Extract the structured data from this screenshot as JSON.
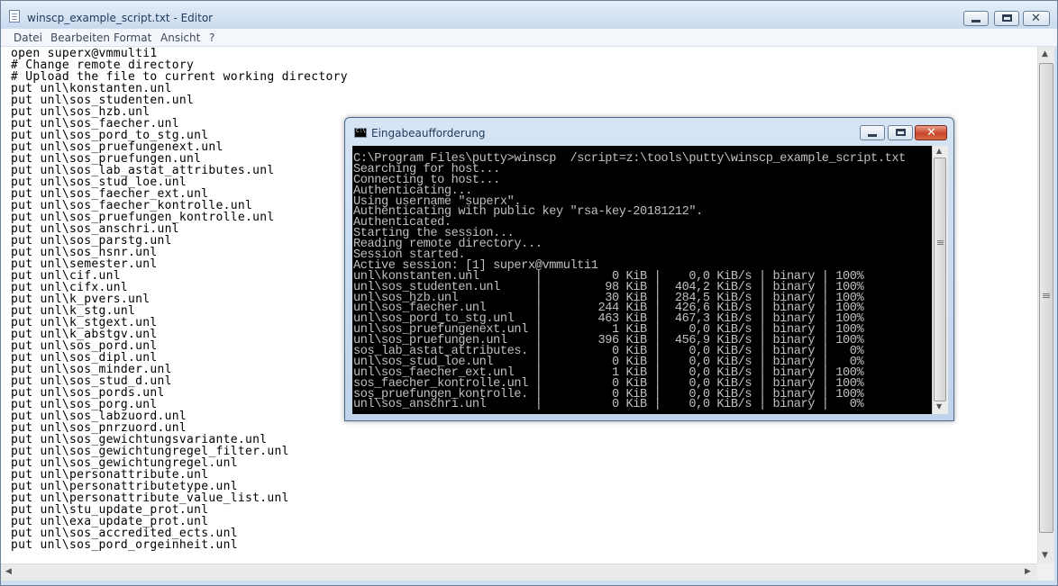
{
  "editor": {
    "title": "winscp_example_script.txt - Editor",
    "menu": [
      "Datei",
      "Bearbeiten",
      "Format",
      "Ansicht",
      "?"
    ],
    "lines": [
      "open superx@vmmulti1",
      "# Change remote directory",
      "# Upload the file to current working directory",
      "put unl\\konstanten.unl",
      "put unl\\sos_studenten.unl",
      "put unl\\sos_hzb.unl",
      "put unl\\sos_faecher.unl",
      "put unl\\sos_pord_to_stg.unl",
      "put unl\\sos_pruefungenext.unl",
      "put unl\\sos_pruefungen.unl",
      "put unl\\sos_lab_astat_attributes.unl",
      "put unl\\sos_stud_loe.unl",
      "put unl\\sos_faecher_ext.unl",
      "put unl\\sos_faecher_kontrolle.unl",
      "put unl\\sos_pruefungen_kontrolle.unl",
      "put unl\\sos_anschri.unl",
      "put unl\\sos_parstg.unl",
      "put unl\\sos_hsnr.unl",
      "put unl\\semester.unl",
      "put unl\\cif.unl",
      "put unl\\cifx.unl",
      "put unl\\k_pvers.unl",
      "put unl\\k_stg.unl",
      "put unl\\k_stgext.unl",
      "put unl\\k_abstgv.unl",
      "put unl\\sos_pord.unl",
      "put unl\\sos_dipl.unl",
      "put unl\\sos_minder.unl",
      "put unl\\sos_stud_d.unl",
      "put unl\\sos_pords.unl",
      "put unl\\sos_porg.unl",
      "put unl\\sos_labzuord.unl",
      "put unl\\sos_pnrzuord.unl",
      "put unl\\sos_gewichtungsvariante.unl",
      "put unl\\sos_gewichtungregel_filter.unl",
      "put unl\\sos_gewichtungregel.unl",
      "put unl\\personattribute.unl",
      "put unl\\personattributetype.unl",
      "put unl\\personattribute_value_list.unl",
      "put unl\\stu_update_prot.unl",
      "put unl\\exa_update_prot.unl",
      "put unl\\sos_accredited_ects.unl",
      "put unl\\sos_pord_orgeinheit.unl"
    ]
  },
  "console": {
    "title": "Eingabeaufforderung",
    "lines": [
      "C:\\Program Files\\putty>winscp  /script=z:\\tools\\putty\\winscp_example_script.txt",
      "Searching for host...",
      "Connecting to host...",
      "Authenticating...",
      "Using username \"superx\".",
      "Authenticating with public key \"rsa-key-20181212\".",
      "Authenticated.",
      "Starting the session...",
      "Reading remote directory...",
      "Session started.",
      "Active session: [1] superx@vmmulti1",
      "unl\\konstanten.unl        |          0 KiB |    0,0 KiB/s | binary | 100%",
      "unl\\sos_studenten.unl     |         98 KiB |  404,2 KiB/s | binary | 100%",
      "unl\\sos_hzb.unl           |         30 KiB |  284,5 KiB/s | binary | 100%",
      "unl\\sos_faecher.unl       |        244 KiB |  426,6 KiB/s | binary | 100%",
      "unl\\sos_pord_to_stg.unl   |        463 KiB |  467,3 KiB/s | binary | 100%",
      "unl\\sos_pruefungenext.unl |          1 KiB |    0,0 KiB/s | binary | 100%",
      "unl\\sos_pruefungen.unl    |        396 KiB |  456,9 KiB/s | binary | 100%",
      "sos_lab_astat_attributes. |          0 KiB |    0,0 KiB/s | binary |   0%",
      "unl\\sos_stud_loe.unl      |          0 KiB |    0,0 KiB/s | binary |   0%",
      "unl\\sos_faecher_ext.unl   |          1 KiB |    0,0 KiB/s | binary | 100%",
      "sos_faecher_kontrolle.unl |          0 KiB |    0,0 KiB/s | binary | 100%",
      "sos_pruefungen_kontrolle. |          0 KiB |    0,0 KiB/s | binary | 100%",
      "unl\\sos_anschri.unl       |          0 KiB |    0,0 KiB/s | binary |   0%"
    ]
  }
}
